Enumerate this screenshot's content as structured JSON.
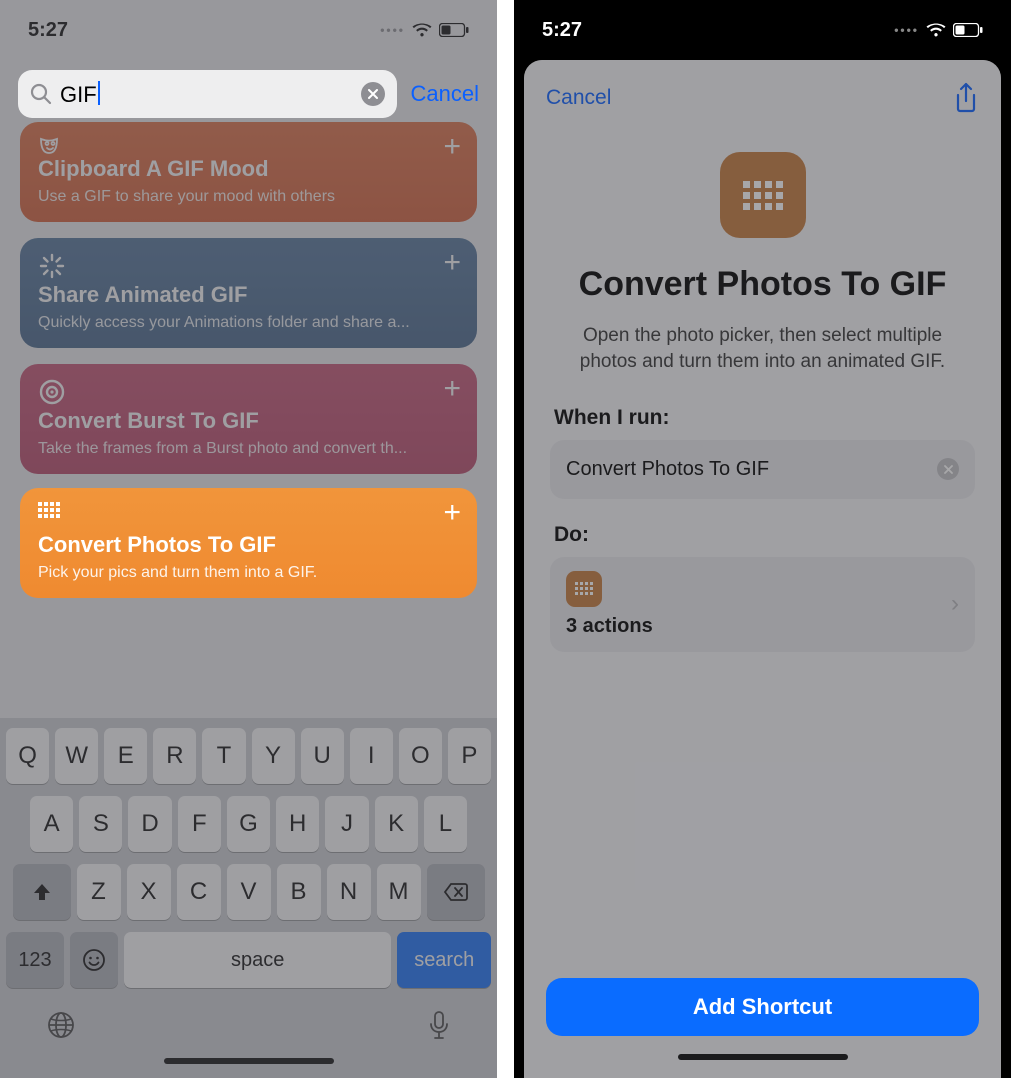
{
  "left": {
    "status": {
      "time": "5:27"
    },
    "search": {
      "query": "GIF",
      "cancel": "Cancel"
    },
    "cards": [
      {
        "title": "Clipboard A GIF Mood",
        "sub": "Use a GIF to share your mood with others"
      },
      {
        "title": "Share Animated GIF",
        "sub": "Quickly access your Animations folder and share a..."
      },
      {
        "title": "Convert Burst To GIF",
        "sub": "Take the frames from a Burst photo and convert th..."
      },
      {
        "title": "Convert Photos To GIF",
        "sub": "Pick your pics and turn them into a GIF."
      }
    ],
    "keyboard": {
      "row1": [
        "Q",
        "W",
        "E",
        "R",
        "T",
        "Y",
        "U",
        "I",
        "O",
        "P"
      ],
      "row2": [
        "A",
        "S",
        "D",
        "F",
        "G",
        "H",
        "J",
        "K",
        "L"
      ],
      "row3": [
        "Z",
        "X",
        "C",
        "V",
        "B",
        "N",
        "M"
      ],
      "numKey": "123",
      "space": "space",
      "search": "search"
    }
  },
  "right": {
    "status": {
      "time": "5:27"
    },
    "sheet": {
      "cancel": "Cancel",
      "title": "Convert Photos To GIF",
      "desc": "Open the photo picker, then select multiple photos and turn them into an animated GIF.",
      "whenLabel": "When I run:",
      "whenValue": "Convert Photos To GIF",
      "doLabel": "Do:",
      "actions": "3 actions",
      "addBtn": "Add Shortcut"
    }
  }
}
